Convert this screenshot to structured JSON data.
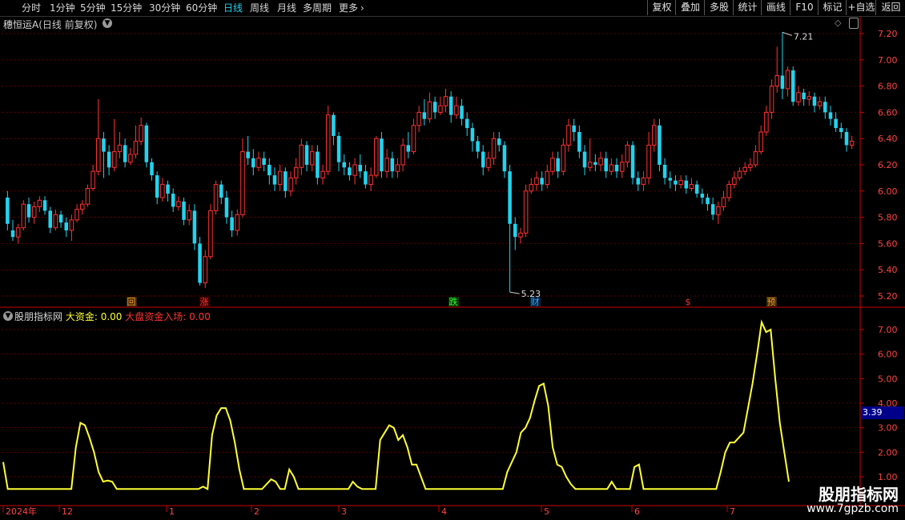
{
  "toolbar": {
    "timeframes": [
      "分时",
      "1分钟",
      "5分钟",
      "15分钟",
      "30分钟",
      "60分钟",
      "日线",
      "周线",
      "月线",
      "多周期",
      "更多"
    ],
    "active_timeframe": "日线",
    "buttons": [
      "复权",
      "叠加",
      "多股",
      "统计",
      "画线",
      "F10",
      "标记",
      "+自选",
      "返回"
    ]
  },
  "stock": {
    "name": "穗恒运A",
    "subtitle": "(日线 前复权)"
  },
  "price_axis": [
    "7.20",
    "7.00",
    "6.80",
    "6.60",
    "6.40",
    "6.20",
    "6.00",
    "5.80",
    "5.60",
    "5.40",
    "5.20"
  ],
  "price_annotations": {
    "high": "7.21",
    "low": "5.23"
  },
  "event_markers": [
    {
      "label": "回",
      "color": "#ff9933",
      "bg": "#3a2a00"
    },
    {
      "label": "涨",
      "color": "#ff3333",
      "bg": "#3a0000"
    },
    {
      "label": "跌",
      "color": "#33ff33",
      "bg": "#003a00"
    },
    {
      "label": "财",
      "color": "#33aaff",
      "bg": "#00203a"
    },
    {
      "label": "$",
      "color": "#ff3333",
      "bg": "#000"
    },
    {
      "label": "预",
      "color": "#ff9933",
      "bg": "#3a2a00"
    }
  ],
  "indicator": {
    "name": "股朋指标网",
    "field1_label": "大资金:",
    "field1_value": "0.00",
    "field2_label": "大盘资金入场:",
    "field2_value": "0.00",
    "axis": [
      "7.00",
      "6.00",
      "5.00",
      "4.00",
      "3.00",
      "2.00",
      "1.00"
    ],
    "current_value": "3.39"
  },
  "date_axis": [
    "2024年",
    "12",
    "1",
    "2",
    "3",
    "4",
    "5",
    "6",
    "7"
  ],
  "watermark": {
    "line1": "股朋指标网",
    "line2": "www.7gpzb.com"
  },
  "colors": {
    "up": "#ff3333",
    "down": "#22d3ee",
    "line": "#ffff33",
    "grid": "#5a0000",
    "axis": "#cc0000"
  },
  "chart_data": [
    {
      "type": "candlestick",
      "title": "穗恒运A (日线 前复权)",
      "ylim": [
        5.15,
        7.3
      ],
      "annotations": [
        {
          "label": "7.21",
          "y": 7.21
        },
        {
          "label": "5.23",
          "y": 5.23
        }
      ],
      "candles": [
        [
          5.95,
          5.75,
          6.0,
          5.7
        ],
        [
          5.7,
          5.65,
          5.78,
          5.62
        ],
        [
          5.65,
          5.72,
          5.75,
          5.6
        ],
        [
          5.72,
          5.9,
          5.93,
          5.7
        ],
        [
          5.9,
          5.8,
          5.95,
          5.76
        ],
        [
          5.8,
          5.88,
          5.92,
          5.75
        ],
        [
          5.88,
          5.93,
          5.96,
          5.84
        ],
        [
          5.93,
          5.85,
          5.96,
          5.82
        ],
        [
          5.85,
          5.72,
          5.88,
          5.68
        ],
        [
          5.72,
          5.82,
          5.86,
          5.7
        ],
        [
          5.82,
          5.76,
          5.85,
          5.72
        ],
        [
          5.76,
          5.7,
          5.8,
          5.65
        ],
        [
          5.7,
          5.78,
          5.82,
          5.62
        ],
        [
          5.78,
          5.86,
          5.9,
          5.76
        ],
        [
          5.86,
          5.9,
          5.93,
          5.82
        ],
        [
          5.9,
          6.02,
          6.05,
          5.88
        ],
        [
          6.02,
          6.15,
          6.2,
          6.0
        ],
        [
          6.15,
          6.4,
          6.7,
          6.12
        ],
        [
          6.4,
          6.3,
          6.45,
          6.1
        ],
        [
          6.3,
          6.18,
          6.35,
          6.12
        ],
        [
          6.18,
          6.3,
          6.55,
          6.15
        ],
        [
          6.3,
          6.35,
          6.45,
          6.25
        ],
        [
          6.35,
          6.22,
          6.4,
          6.18
        ],
        [
          6.22,
          6.28,
          6.33,
          6.2
        ],
        [
          6.28,
          6.38,
          6.5,
          6.25
        ],
        [
          6.38,
          6.5,
          6.56,
          6.35
        ],
        [
          6.5,
          6.22,
          6.52,
          6.18
        ],
        [
          6.22,
          6.12,
          6.25,
          6.08
        ],
        [
          6.12,
          5.95,
          6.15,
          5.9
        ],
        [
          5.95,
          6.05,
          6.1,
          5.92
        ],
        [
          6.05,
          5.98,
          6.08,
          5.92
        ],
        [
          5.98,
          5.88,
          6.02,
          5.84
        ],
        [
          5.88,
          5.92,
          5.96,
          5.85
        ],
        [
          5.92,
          5.78,
          5.95,
          5.74
        ],
        [
          5.78,
          5.85,
          5.9,
          5.74
        ],
        [
          5.85,
          5.6,
          5.9,
          5.55
        ],
        [
          5.6,
          5.3,
          5.65,
          5.28
        ],
        [
          5.3,
          5.5,
          5.55,
          5.26
        ],
        [
          5.5,
          5.85,
          5.9,
          5.48
        ],
        [
          5.85,
          6.05,
          6.08,
          5.82
        ],
        [
          6.05,
          5.95,
          6.08,
          5.9
        ],
        [
          5.95,
          5.8,
          6.0,
          5.75
        ],
        [
          5.8,
          5.7,
          5.85,
          5.65
        ],
        [
          5.7,
          5.82,
          5.86,
          5.66
        ],
        [
          5.82,
          6.3,
          6.4,
          5.8
        ],
        [
          6.3,
          6.25,
          6.42,
          6.2
        ],
        [
          6.25,
          6.18,
          6.32,
          6.12
        ],
        [
          6.18,
          6.25,
          6.3,
          6.15
        ],
        [
          6.25,
          6.2,
          6.3,
          6.15
        ],
        [
          6.2,
          6.12,
          6.25,
          6.05
        ],
        [
          6.12,
          6.05,
          6.18,
          6.0
        ],
        [
          6.05,
          6.15,
          6.2,
          6.0
        ],
        [
          6.15,
          6.0,
          6.18,
          5.95
        ],
        [
          6.0,
          6.1,
          6.15,
          5.96
        ],
        [
          6.1,
          6.18,
          6.25,
          6.05
        ],
        [
          6.18,
          6.35,
          6.4,
          6.12
        ],
        [
          6.35,
          6.2,
          6.38,
          6.15
        ],
        [
          6.2,
          6.3,
          6.35,
          6.15
        ],
        [
          6.3,
          6.1,
          6.35,
          6.05
        ],
        [
          6.1,
          6.15,
          6.2,
          6.05
        ],
        [
          6.15,
          6.58,
          6.65,
          6.12
        ],
        [
          6.58,
          6.42,
          6.6,
          6.35
        ],
        [
          6.42,
          6.22,
          6.45,
          6.15
        ],
        [
          6.22,
          6.18,
          6.28,
          6.12
        ],
        [
          6.18,
          6.12,
          6.22,
          6.08
        ],
        [
          6.12,
          6.2,
          6.25,
          6.05
        ],
        [
          6.2,
          6.15,
          6.28,
          6.1
        ],
        [
          6.15,
          6.05,
          6.2,
          6.02
        ],
        [
          6.05,
          6.12,
          6.18,
          6.0
        ],
        [
          6.12,
          6.4,
          6.42,
          6.1
        ],
        [
          6.4,
          6.15,
          6.45,
          6.1
        ],
        [
          6.15,
          6.25,
          6.32,
          6.1
        ],
        [
          6.25,
          6.15,
          6.3,
          6.1
        ],
        [
          6.15,
          6.2,
          6.25,
          6.1
        ],
        [
          6.2,
          6.35,
          6.4,
          6.15
        ],
        [
          6.35,
          6.3,
          6.45,
          6.25
        ],
        [
          6.3,
          6.5,
          6.55,
          6.28
        ],
        [
          6.5,
          6.6,
          6.65,
          6.45
        ],
        [
          6.6,
          6.55,
          6.7,
          6.5
        ],
        [
          6.55,
          6.68,
          6.75,
          6.52
        ],
        [
          6.68,
          6.6,
          6.72,
          6.55
        ],
        [
          6.6,
          6.65,
          6.72,
          6.58
        ],
        [
          6.65,
          6.72,
          6.78,
          6.6
        ],
        [
          6.72,
          6.58,
          6.76,
          6.52
        ],
        [
          6.58,
          6.65,
          6.72,
          6.55
        ],
        [
          6.65,
          6.55,
          6.7,
          6.5
        ],
        [
          6.55,
          6.48,
          6.6,
          6.42
        ],
        [
          6.48,
          6.38,
          6.52,
          6.3
        ],
        [
          6.38,
          6.3,
          6.42,
          6.25
        ],
        [
          6.3,
          6.18,
          6.35,
          6.12
        ],
        [
          6.18,
          6.25,
          6.3,
          6.15
        ],
        [
          6.25,
          6.4,
          6.45,
          6.2
        ],
        [
          6.4,
          6.35,
          6.45,
          6.3
        ],
        [
          6.35,
          6.15,
          6.38,
          6.1
        ],
        [
          6.15,
          5.75,
          6.2,
          5.23
        ],
        [
          5.75,
          5.65,
          5.8,
          5.55
        ],
        [
          5.65,
          5.68,
          5.72,
          5.6
        ],
        [
          5.68,
          6.0,
          6.05,
          5.65
        ],
        [
          6.0,
          6.05,
          6.1,
          5.98
        ],
        [
          6.05,
          6.1,
          6.15,
          6.0
        ],
        [
          6.1,
          6.05,
          6.15,
          6.0
        ],
        [
          6.05,
          6.15,
          6.2,
          6.02
        ],
        [
          6.15,
          6.25,
          6.3,
          6.12
        ],
        [
          6.25,
          6.15,
          6.3,
          6.1
        ],
        [
          6.15,
          6.35,
          6.4,
          6.12
        ],
        [
          6.35,
          6.5,
          6.55,
          6.3
        ],
        [
          6.5,
          6.45,
          6.55,
          6.38
        ],
        [
          6.45,
          6.3,
          6.5,
          6.25
        ],
        [
          6.3,
          6.18,
          6.35,
          6.12
        ],
        [
          6.18,
          6.22,
          6.4,
          6.15
        ],
        [
          6.22,
          6.2,
          6.28,
          6.15
        ],
        [
          6.2,
          6.25,
          6.3,
          6.15
        ],
        [
          6.25,
          6.15,
          6.3,
          6.1
        ],
        [
          6.15,
          6.2,
          6.25,
          6.12
        ],
        [
          6.2,
          6.15,
          6.25,
          6.1
        ],
        [
          6.15,
          6.22,
          6.28,
          6.1
        ],
        [
          6.22,
          6.35,
          6.38,
          6.18
        ],
        [
          6.35,
          6.1,
          6.38,
          6.05
        ],
        [
          6.1,
          6.05,
          6.15,
          6.0
        ],
        [
          6.05,
          6.1,
          6.15,
          6.0
        ],
        [
          6.1,
          6.35,
          6.45,
          6.05
        ],
        [
          6.35,
          6.5,
          6.55,
          6.3
        ],
        [
          6.5,
          6.2,
          6.55,
          6.15
        ],
        [
          6.2,
          6.1,
          6.25,
          6.05
        ],
        [
          6.1,
          6.08,
          6.15,
          6.02
        ],
        [
          6.08,
          6.05,
          6.12,
          6.0
        ],
        [
          6.05,
          6.08,
          6.12,
          6.02
        ],
        [
          6.08,
          6.02,
          6.12,
          5.98
        ],
        [
          6.02,
          6.05,
          6.1,
          6.0
        ],
        [
          6.05,
          5.98,
          6.08,
          5.95
        ],
        [
          5.98,
          5.95,
          6.02,
          5.9
        ],
        [
          5.95,
          5.9,
          5.98,
          5.85
        ],
        [
          5.9,
          5.82,
          5.95,
          5.78
        ],
        [
          5.82,
          5.88,
          5.92,
          5.75
        ],
        [
          5.88,
          5.95,
          6.0,
          5.85
        ],
        [
          5.95,
          6.05,
          6.08,
          5.92
        ],
        [
          6.05,
          6.1,
          6.15,
          6.02
        ],
        [
          6.1,
          6.15,
          6.18,
          6.08
        ],
        [
          6.15,
          6.18,
          6.22,
          6.12
        ],
        [
          6.18,
          6.2,
          6.25,
          6.15
        ],
        [
          6.2,
          6.3,
          6.35,
          6.18
        ],
        [
          6.3,
          6.45,
          6.5,
          6.28
        ],
        [
          6.45,
          6.6,
          6.65,
          6.42
        ],
        [
          6.6,
          6.8,
          6.85,
          6.55
        ],
        [
          6.8,
          6.88,
          7.1,
          6.75
        ],
        [
          6.88,
          6.78,
          7.21,
          6.7
        ],
        [
          6.78,
          6.92,
          6.95,
          6.72
        ],
        [
          6.92,
          6.68,
          6.95,
          6.65
        ],
        [
          6.68,
          6.75,
          6.8,
          6.65
        ],
        [
          6.75,
          6.7,
          6.78,
          6.65
        ],
        [
          6.7,
          6.72,
          6.76,
          6.65
        ],
        [
          6.72,
          6.65,
          6.75,
          6.6
        ],
        [
          6.65,
          6.68,
          6.72,
          6.62
        ],
        [
          6.68,
          6.6,
          6.72,
          6.55
        ],
        [
          6.6,
          6.55,
          6.65,
          6.5
        ],
        [
          6.55,
          6.48,
          6.6,
          6.45
        ],
        [
          6.48,
          6.45,
          6.52,
          6.4
        ],
        [
          6.45,
          6.35,
          6.48,
          6.3
        ],
        [
          6.35,
          6.38,
          6.42,
          6.32
        ]
      ]
    },
    {
      "type": "line",
      "title": "股朋指标网",
      "ylim": [
        0.5,
        7.6
      ],
      "series": [
        {
          "name": "大资金",
          "values": [
            1.6,
            0.5,
            0.5,
            0.5,
            0.5,
            0.5,
            0.5,
            0.5,
            0.5,
            0.5,
            0.5,
            0.5,
            0.5,
            0.5,
            0.5,
            0.5,
            2.2,
            3.2,
            3.1,
            2.6,
            2.0,
            1.2,
            0.8,
            0.85,
            0.8,
            0.5,
            0.5,
            0.5,
            0.5,
            0.5,
            0.5,
            0.5,
            0.5,
            0.5,
            0.5,
            0.5,
            0.5,
            0.5,
            0.5,
            0.5,
            0.5,
            0.5,
            0.5,
            0.5,
            0.6,
            0.5,
            2.7,
            3.5,
            3.8,
            3.8,
            3.3,
            2.4,
            1.3,
            0.5,
            0.5,
            0.5,
            0.5,
            0.5,
            0.7,
            0.9,
            0.8,
            0.5,
            0.5,
            1.3,
            1.0,
            0.5,
            0.5,
            0.5,
            0.5,
            0.5,
            0.5,
            0.5,
            0.5,
            0.5,
            0.5,
            0.5,
            0.5,
            0.8,
            0.6,
            0.5,
            0.5,
            0.5,
            0.5,
            2.5,
            2.8,
            3.1,
            3.0,
            2.5,
            2.7,
            2.2,
            1.5,
            1.5,
            1.0,
            0.5,
            0.5,
            0.5,
            0.5,
            0.5,
            0.5,
            0.5,
            0.5,
            0.5,
            0.5,
            0.5,
            0.5,
            0.5,
            0.5,
            0.5,
            0.5,
            0.5,
            0.5,
            1.2,
            1.6,
            2.0,
            2.8,
            3.0,
            3.4,
            4.1,
            4.7,
            4.8,
            3.9,
            2.2,
            1.5,
            1.4,
            1.0,
            0.7,
            0.5,
            0.5,
            0.5,
            0.5,
            0.5,
            0.5,
            0.5,
            0.5,
            0.8,
            0.5,
            0.5,
            0.5,
            0.5,
            1.4,
            1.5,
            0.5,
            0.5,
            0.5,
            0.5,
            0.5,
            0.5,
            0.5,
            0.5,
            0.5,
            0.5,
            0.5,
            0.5,
            0.5,
            0.5,
            0.5,
            0.5,
            0.5,
            1.2,
            2.0,
            2.4,
            2.4,
            2.6,
            2.8,
            3.8,
            4.8,
            6.0,
            7.3,
            6.9,
            7.0,
            5.0,
            3.2,
            2.0,
            0.8
          ]
        }
      ]
    }
  ]
}
